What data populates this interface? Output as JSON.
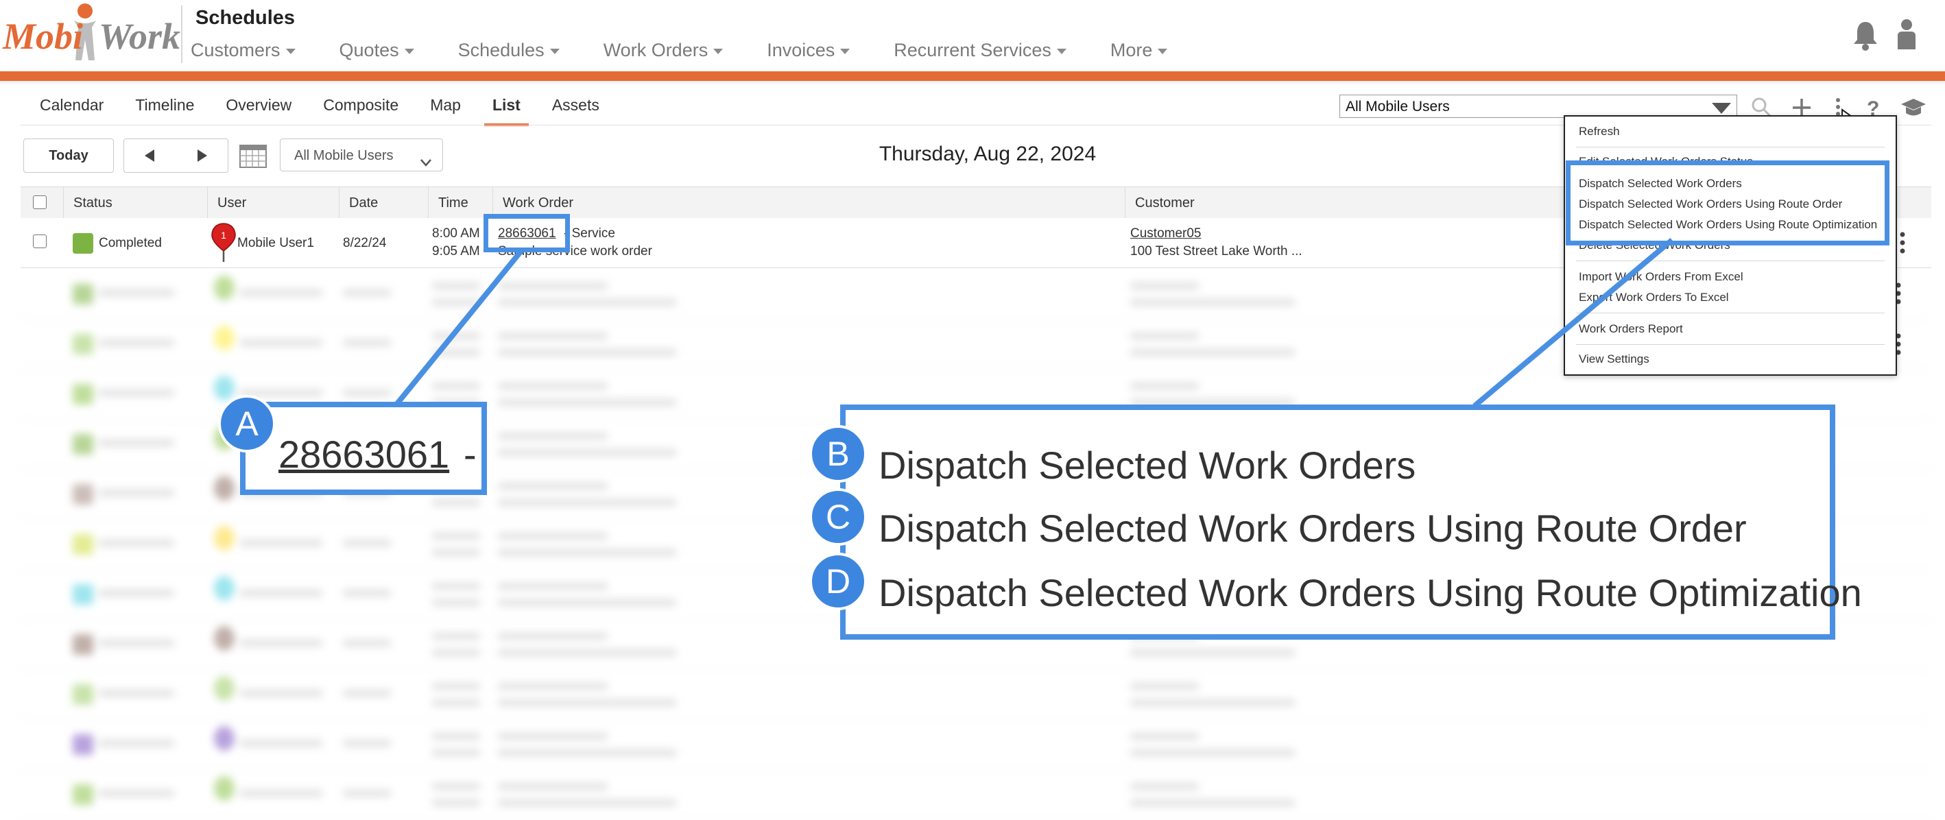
{
  "app": {
    "logo_left": "Mobi",
    "logo_right": "Work",
    "title": "Schedules"
  },
  "topnav": {
    "items": [
      {
        "label": "Customers"
      },
      {
        "label": "Quotes"
      },
      {
        "label": "Schedules"
      },
      {
        "label": "Work Orders"
      },
      {
        "label": "Invoices"
      },
      {
        "label": "Recurrent Services"
      },
      {
        "label": "More"
      }
    ]
  },
  "subtabs": {
    "items": [
      {
        "label": "Calendar"
      },
      {
        "label": "Timeline"
      },
      {
        "label": "Overview"
      },
      {
        "label": "Composite"
      },
      {
        "label": "Map"
      },
      {
        "label": "List"
      },
      {
        "label": "Assets"
      }
    ],
    "active": "List"
  },
  "toolbar": {
    "user_select": "All Mobile Users",
    "today_label": "Today",
    "user_filter": "All Mobile Users",
    "date_title": "Thursday, Aug 22, 2024"
  },
  "table": {
    "headers": {
      "status": "Status",
      "user": "User",
      "date": "Date",
      "time": "Time",
      "work_order": "Work Order",
      "customer": "Customer"
    },
    "row": {
      "status": "Completed",
      "status_color": "#7cb342",
      "user_pin_number": "1",
      "user": "Mobile User1",
      "date": "8/22/24",
      "time_start": "8:00 AM",
      "time_end": "9:05 AM",
      "work_order_id": "28663061",
      "work_order_type": "- Service",
      "work_order_desc": "Sample service work order",
      "customer": "Customer05",
      "customer_address": "100 Test Street  Lake Worth ..."
    }
  },
  "menu": {
    "items": [
      "Refresh",
      "Edit Selected Work Orders Status",
      "Dispatch Selected Work Orders",
      "Dispatch Selected Work Orders Using Route Order",
      "Dispatch Selected Work Orders Using Route Optimization",
      "Delete Selected Work Orders",
      "Import Work Orders From Excel",
      "Export Work Orders To Excel",
      "Work Orders Report",
      "View Settings"
    ]
  },
  "callouts": {
    "a": {
      "badge": "A",
      "text": "28663061",
      "suffix": "-"
    },
    "b": {
      "badge": "B",
      "text": "Dispatch Selected Work Orders"
    },
    "c": {
      "badge": "C",
      "text": "Dispatch Selected Work Orders Using Route Order"
    },
    "d": {
      "badge": "D",
      "text": "Dispatch Selected Work Orders Using Route Optimization"
    }
  },
  "colors": {
    "accent": "#e46a36",
    "callout_blue": "#4a90e2"
  },
  "icons": [
    "bell-icon",
    "person-icon",
    "search-icon",
    "add-icon",
    "more-vertical-icon",
    "help-icon",
    "graduation-cap-icon",
    "calendar-icon",
    "map-pin-icon"
  ]
}
